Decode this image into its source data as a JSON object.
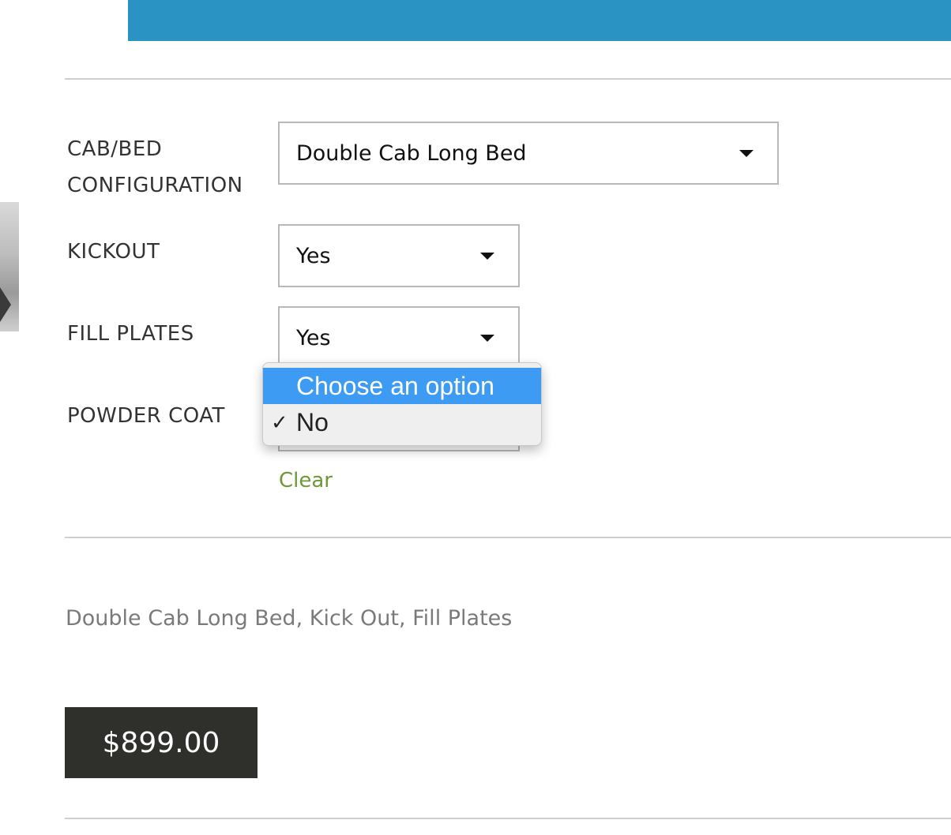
{
  "form": {
    "cab_bed": {
      "label": "CAB/BED CONFIGURATION",
      "value": "Double Cab Long Bed"
    },
    "kickout": {
      "label": "KICKOUT",
      "value": "Yes"
    },
    "fill_plates": {
      "label": "FILL PLATES",
      "value": "Yes"
    },
    "powder_coat": {
      "label": "POWDER COAT",
      "value": "No"
    },
    "clear_label": "Clear"
  },
  "dropdown": {
    "options": [
      {
        "label": "Choose an option",
        "highlighted": true
      },
      {
        "label": "No",
        "checked": true
      }
    ],
    "check_glyph": "✓"
  },
  "summary": "Double Cab Long Bed, Kick Out, Fill Plates",
  "price": "$899.00",
  "colors": {
    "top_bar": "#2a93c4",
    "highlight": "#3e9bf3",
    "clear_link": "#6d9a36",
    "price_bg": "#2f302c"
  }
}
